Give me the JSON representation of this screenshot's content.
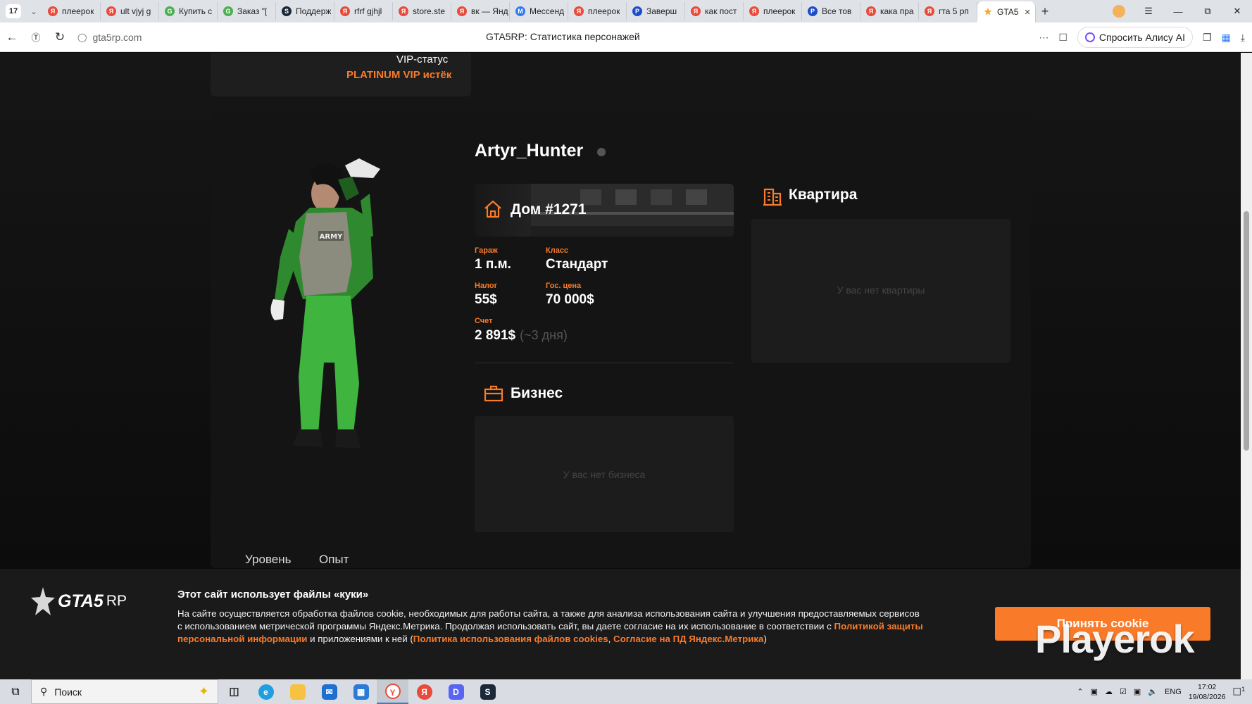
{
  "browser": {
    "tab_count": "17",
    "tabs": [
      {
        "title": "плеерок",
        "fav": "Я",
        "color": "#e84a3b"
      },
      {
        "title": "ult vjyj g",
        "fav": "Я",
        "color": "#e84a3b"
      },
      {
        "title": "Купить с",
        "fav": "G",
        "color": "#4caf50"
      },
      {
        "title": "Заказ \"[",
        "fav": "G",
        "color": "#4caf50"
      },
      {
        "title": "Поддерж",
        "fav": "S",
        "color": "#1b2838"
      },
      {
        "title": "rfrf gjhjl",
        "fav": "Я",
        "color": "#e84a3b"
      },
      {
        "title": "store.ste",
        "fav": "Я",
        "color": "#e84a3b"
      },
      {
        "title": "вк — Янд",
        "fav": "Я",
        "color": "#e84a3b"
      },
      {
        "title": "Мессенд",
        "fav": "M",
        "color": "#2d7cf6"
      },
      {
        "title": "плеерок",
        "fav": "Я",
        "color": "#e84a3b"
      },
      {
        "title": "Заверш",
        "fav": "P",
        "color": "#1f4cc9"
      },
      {
        "title": "как пост",
        "fav": "Я",
        "color": "#e84a3b"
      },
      {
        "title": "плеерок",
        "fav": "Я",
        "color": "#e84a3b"
      },
      {
        "title": "Все тов",
        "fav": "P",
        "color": "#1f4cc9"
      },
      {
        "title": "кака пра",
        "fav": "Я",
        "color": "#e84a3b"
      },
      {
        "title": "гта 5 рп",
        "fav": "Я",
        "color": "#e84a3b"
      }
    ],
    "active_tab": {
      "title": "GTA5",
      "fav": "★",
      "color": "#f5a623"
    },
    "url": "gta5rp.com",
    "page_title": "GTA5RP: Статистика персонажей",
    "alice_label": "Спросить Алису AI"
  },
  "vip": {
    "label": "VIP-статус",
    "value": "PLATINUM VIP истёк"
  },
  "character": {
    "name": "Artyr_Hunter",
    "vest_text": "ARMY"
  },
  "house": {
    "title": "Дом #1271",
    "garage_label": "Гараж",
    "garage_value": "1 п.м.",
    "class_label": "Класс",
    "class_value": "Стандарт",
    "tax_label": "Налог",
    "tax_value": "55$",
    "gov_price_label": "Гос. цена",
    "gov_price_value": "70 000$",
    "account_label": "Счет",
    "account_value": "2 891$",
    "account_days": "(~3 дня)"
  },
  "apartment": {
    "title": "Квартира",
    "empty": "У вас нет квартиры"
  },
  "business": {
    "title": "Бизнес",
    "empty": "У вас нет бизнеса"
  },
  "stats_tabs": {
    "level": "Уровень",
    "experience": "Опыт"
  },
  "cookie": {
    "logo_main": "GTA5",
    "logo_rp": "RP",
    "title": "Этот сайт использует файлы «куки»",
    "text_1": "На сайте осуществляется обработка файлов cookie, необходимых для работы сайта, а также для анализа использования сайта и улучшения предоставляемых сервисов с использованием метрической программы Яндекс.Метрика. Продолжая использовать сайт, вы даете согласие на их использование в соответствии с ",
    "link_privacy": "Политикой защиты персональной информации",
    "text_2": " и приложениями к ней (",
    "link_cookies": "Политика использования файлов cookies",
    "text_3": ", ",
    "link_metrica": "Согласие на ПД Яндекс.Метрика",
    "text_4": ")",
    "accept": "Принять cookie"
  },
  "watermark": "Playerok",
  "taskbar": {
    "search_placeholder": "Поиск",
    "lang": "ENG",
    "time": "17:02",
    "date": "19/08/2026",
    "notif_count": "1"
  },
  "colors": {
    "accent": "#f97b2a",
    "card_bg": "#141414",
    "page_bg": "#0d0d0d"
  }
}
